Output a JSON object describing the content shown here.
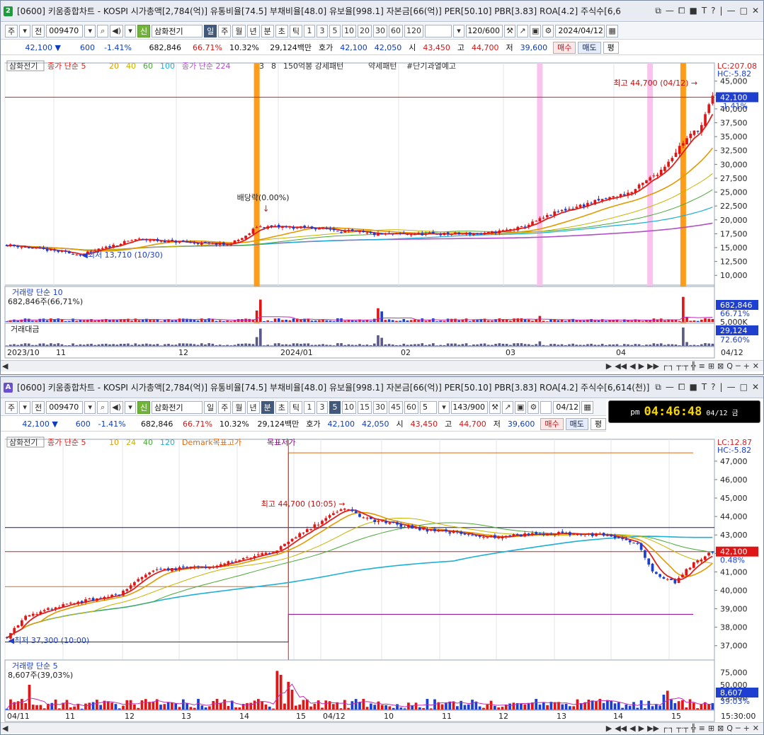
{
  "top": {
    "badge": "2",
    "title": "[0600] 키움종합차트 - KOSPI 시가총액[2,784(억)] 유통비율[74.5] 부채비율[48.0] 유보율[998.1] 자본금[66(억)] PER[50.10] PBR[3.83] ROA[4.2] 주식수[6,6",
    "win_icons": [
      "⧉",
      "—",
      "⧠",
      "■",
      "T",
      "?",
      "|",
      "—",
      "□",
      "✕"
    ],
    "tool": {
      "market": "주",
      "prev": "전",
      "code": "009470",
      "name": "삼화전기",
      "periods": [
        "일",
        "주",
        "월",
        "년",
        "분",
        "초",
        "틱"
      ],
      "active_period": "일",
      "nums": [
        "1",
        "3",
        "5",
        "10",
        "20",
        "30",
        "60",
        "120"
      ],
      "count": "120/600",
      "date": "2024/04/12"
    },
    "quote": {
      "price": "42,100 ▼",
      "change": "600",
      "rate": "-1.41%",
      "volume": "682,846",
      "vol_rate": "66.71%",
      "turnover": "10.32%",
      "amount": "29,124백만",
      "hoga_label": "호가",
      "ask": "42,100",
      "bid": "42,050",
      "open_label": "시",
      "open": "43,450",
      "high_label": "고",
      "high": "44,700",
      "low_label": "저",
      "low": "39,600",
      "buy": "매수",
      "sell": "매도",
      "eval": "평"
    },
    "hscroll": "┌·┐ ┬·┬",
    "hscroll_icons": [
      "▶",
      "◀◀",
      "◀",
      "▶",
      "▶▶",
      "─",
      "╬",
      "≡",
      "⊞",
      "⊠",
      "Q",
      "─",
      "+",
      "✕"
    ]
  },
  "chart_data": [
    {
      "type": "candlestick",
      "title": "",
      "stock": "삼화전기",
      "legend": [
        {
          "text": "삼화전기",
          "color": "#333333"
        },
        {
          "text": "종가 단순 5",
          "color": "#e0201a"
        },
        {
          "text": "20",
          "color": "#e39a00"
        },
        {
          "text": "40",
          "color": "#c9b400"
        },
        {
          "text": "60",
          "color": "#4aa838"
        },
        {
          "text": "100",
          "color": "#1cb0d8"
        },
        {
          "text": "종가 단순 224",
          "color": "#b04fc7"
        },
        {
          "text": "3",
          "color": "#333333"
        },
        {
          "text": "8",
          "color": "#333333"
        },
        {
          "text": "150억봉 강세패턴",
          "color": "#333333"
        },
        {
          "text": "약세패턴",
          "color": "#333333"
        },
        {
          "text": "#단기과열예고",
          "color": "#333333"
        }
      ],
      "x_labels": [
        "2023/10",
        "11",
        "12",
        "2024/01",
        "02",
        "03",
        "04",
        "04/12"
      ],
      "y_ticks": [
        "45,000",
        "42,500",
        "40,000",
        "37,500",
        "35,000",
        "32,500",
        "30,000",
        "27,500",
        "25,000",
        "22,500",
        "20,000",
        "17,500",
        "15,000",
        "12,500",
        "10,000"
      ],
      "ylim": [
        8500,
        47000
      ],
      "right_labels": {
        "lc": "LC:207.08",
        "hc": "HC:-5.82",
        "price": "42,100",
        "rate": "-1.41%"
      },
      "current_price": 42100,
      "annotations": [
        {
          "text": "최고 44,700 (04/12)",
          "value": 44700
        },
        {
          "text": "최저 13,710 (10/30)",
          "value": 13710
        },
        {
          "text": "배당락(0.00%)",
          "value": 20000
        }
      ],
      "close_anchor": [
        [
          0,
          15500
        ],
        [
          15,
          14200
        ],
        [
          20,
          13710
        ],
        [
          35,
          16500
        ],
        [
          60,
          15500
        ],
        [
          65,
          17000
        ],
        [
          68,
          18800
        ],
        [
          85,
          18500
        ],
        [
          100,
          17400
        ],
        [
          130,
          17500
        ],
        [
          140,
          18600
        ],
        [
          150,
          21500
        ],
        [
          170,
          25000
        ],
        [
          178,
          29000
        ],
        [
          184,
          34000
        ],
        [
          189,
          37000
        ],
        [
          192,
          42100
        ]
      ],
      "highlight_bars": [
        {
          "kind": "orange",
          "value": 68
        },
        {
          "kind": "pink",
          "value": 145
        },
        {
          "kind": "pink",
          "value": 175
        },
        {
          "kind": "orange",
          "value": 184
        }
      ],
      "volume": {
        "label": "거래량 단순 10",
        "value_text": "682,846주(66,71%)",
        "y_ticks": [
          "5,000K"
        ],
        "right_labels": {
          "value": "682,846",
          "rate": "66.71%"
        },
        "max": 5600000,
        "spikes": [
          [
            68,
            2500000
          ],
          [
            69,
            4900000
          ],
          [
            101,
            3000000
          ],
          [
            102,
            2300000
          ],
          [
            145,
            1300000
          ],
          [
            184,
            5500000
          ],
          [
            185,
            1100000
          ],
          [
            190,
            800000
          ],
          [
            191,
            700000
          ]
        ]
      },
      "amount": {
        "label": "거래대금",
        "right_labels": {
          "value": "29,124",
          "rate": "72.60%"
        }
      }
    },
    {
      "type": "candlestick",
      "title": "",
      "stock": "삼화전기",
      "legend": [
        {
          "text": "삼화전기",
          "color": "#333333"
        },
        {
          "text": "종가 단순 5",
          "color": "#e0201a"
        },
        {
          "text": "10",
          "color": "#e39a00"
        },
        {
          "text": "24",
          "color": "#c9b400"
        },
        {
          "text": "40",
          "color": "#4aa838"
        },
        {
          "text": "120",
          "color": "#1cb0d8"
        },
        {
          "text": "Demark목표고가",
          "color": "#e06a10"
        },
        {
          "text": "목표저가",
          "color": "#8b008b"
        }
      ],
      "x_labels": [
        "04/11",
        "11",
        "12",
        "13",
        "14",
        "15",
        "04/12",
        "10",
        "11",
        "12",
        "13",
        "14",
        "15",
        "15:30:00"
      ],
      "y_ticks": [
        "47,000",
        "46,000",
        "45,000",
        "44,000",
        "43,000",
        "42,000",
        "41,000",
        "40,000",
        "39,000",
        "38,000",
        "37,000"
      ],
      "ylim": [
        36300,
        47800
      ],
      "right_labels": {
        "lc": "LC:12.87",
        "hc": "HC:-5.82",
        "price": "42,100",
        "rate": "0.48%"
      },
      "current_price": 42100,
      "ref_lines": [
        {
          "value": 43400,
          "color": "#1a1a6a"
        },
        {
          "value": 42100,
          "color": "#d42020"
        }
      ],
      "demark": {
        "high_d1": 40200,
        "high_d2": 47450,
        "low_d1": 37200,
        "low_d2": 38700
      },
      "annotations": [
        {
          "text": "최고 44,700 (10:05)",
          "value": 44700
        },
        {
          "text": "최저 37,300 (10:00)",
          "value": 37300
        }
      ],
      "close_anchor": [
        [
          0,
          37500
        ],
        [
          5,
          38600
        ],
        [
          15,
          39200
        ],
        [
          30,
          39800
        ],
        [
          35,
          40600
        ],
        [
          40,
          41100
        ],
        [
          55,
          41300
        ],
        [
          65,
          41800
        ],
        [
          72,
          42100
        ],
        [
          74,
          42600
        ],
        [
          82,
          43500
        ],
        [
          87,
          44200
        ],
        [
          90,
          44500
        ],
        [
          95,
          43900
        ],
        [
          110,
          43300
        ],
        [
          130,
          42900
        ],
        [
          145,
          43100
        ],
        [
          158,
          43000
        ],
        [
          168,
          42500
        ],
        [
          172,
          41000
        ],
        [
          178,
          40400
        ],
        [
          182,
          41300
        ],
        [
          186,
          41900
        ],
        [
          188,
          42100
        ]
      ],
      "volume": {
        "label": "거래량 단순 5",
        "value_text": "8,607주(39,03%)",
        "y_ticks": [
          "75,000",
          "50,000",
          "25,000"
        ],
        "right_labels": {
          "value": "8,607",
          "rate": "39.03%"
        },
        "max": 80000,
        "spikes": [
          [
            6,
            50000
          ],
          [
            72,
            78000
          ],
          [
            73,
            70000
          ],
          [
            75,
            56000
          ],
          [
            76,
            40000
          ],
          [
            175,
            30000
          ],
          [
            176,
            38000
          ]
        ]
      }
    }
  ],
  "bottom": {
    "badge": "A",
    "title": "[0600] 키움종합차트 - KOSPI 시가총액[2,784(억)] 유통비율[74.5] 부채비율[48.0] 유보율[998.1] 자본금[66(억)] PER[50.10] PBR[3.83] ROA[4.2] 주식수[6,614(천)]",
    "win_icons": [
      "⧉",
      "—",
      "⧠",
      "■",
      "T",
      "?",
      "|",
      "—",
      "□",
      "✕"
    ],
    "tool": {
      "market": "주",
      "prev": "전",
      "code": "009470",
      "name": "삼화전기",
      "periods": [
        "일",
        "주",
        "월",
        "년",
        "분",
        "초",
        "틱"
      ],
      "active_period": "분",
      "nums": [
        "1",
        "3",
        "5",
        "10",
        "15",
        "30",
        "45",
        "60"
      ],
      "active_num": "5",
      "interval": "5",
      "count": "143/900",
      "date": "04/12"
    },
    "quote": {
      "price": "42,100 ▼",
      "change": "600",
      "rate": "-1.41%",
      "volume": "682,846",
      "vol_rate": "66.71%",
      "turnover": "10.32%",
      "amount": "29,124백만",
      "hoga_label": "호가",
      "ask": "42,100",
      "bid": "42,050",
      "open_label": "시",
      "open": "43,450",
      "high_label": "고",
      "high": "44,700",
      "low_label": "저",
      "low": "39,600",
      "buy": "매수",
      "sell": "매도",
      "eval": "평"
    },
    "clock": {
      "ampm": "pm",
      "time": "04:46:48",
      "date": "04/12 금"
    },
    "hscroll": "┌·┐ ┬·┬",
    "hscroll_icons": [
      "▶",
      "◀◀",
      "◀",
      "▶",
      "▶▶",
      "─",
      "╬",
      "≡",
      "⊞",
      "⊠",
      "Q",
      "─",
      "+",
      "✕"
    ]
  }
}
